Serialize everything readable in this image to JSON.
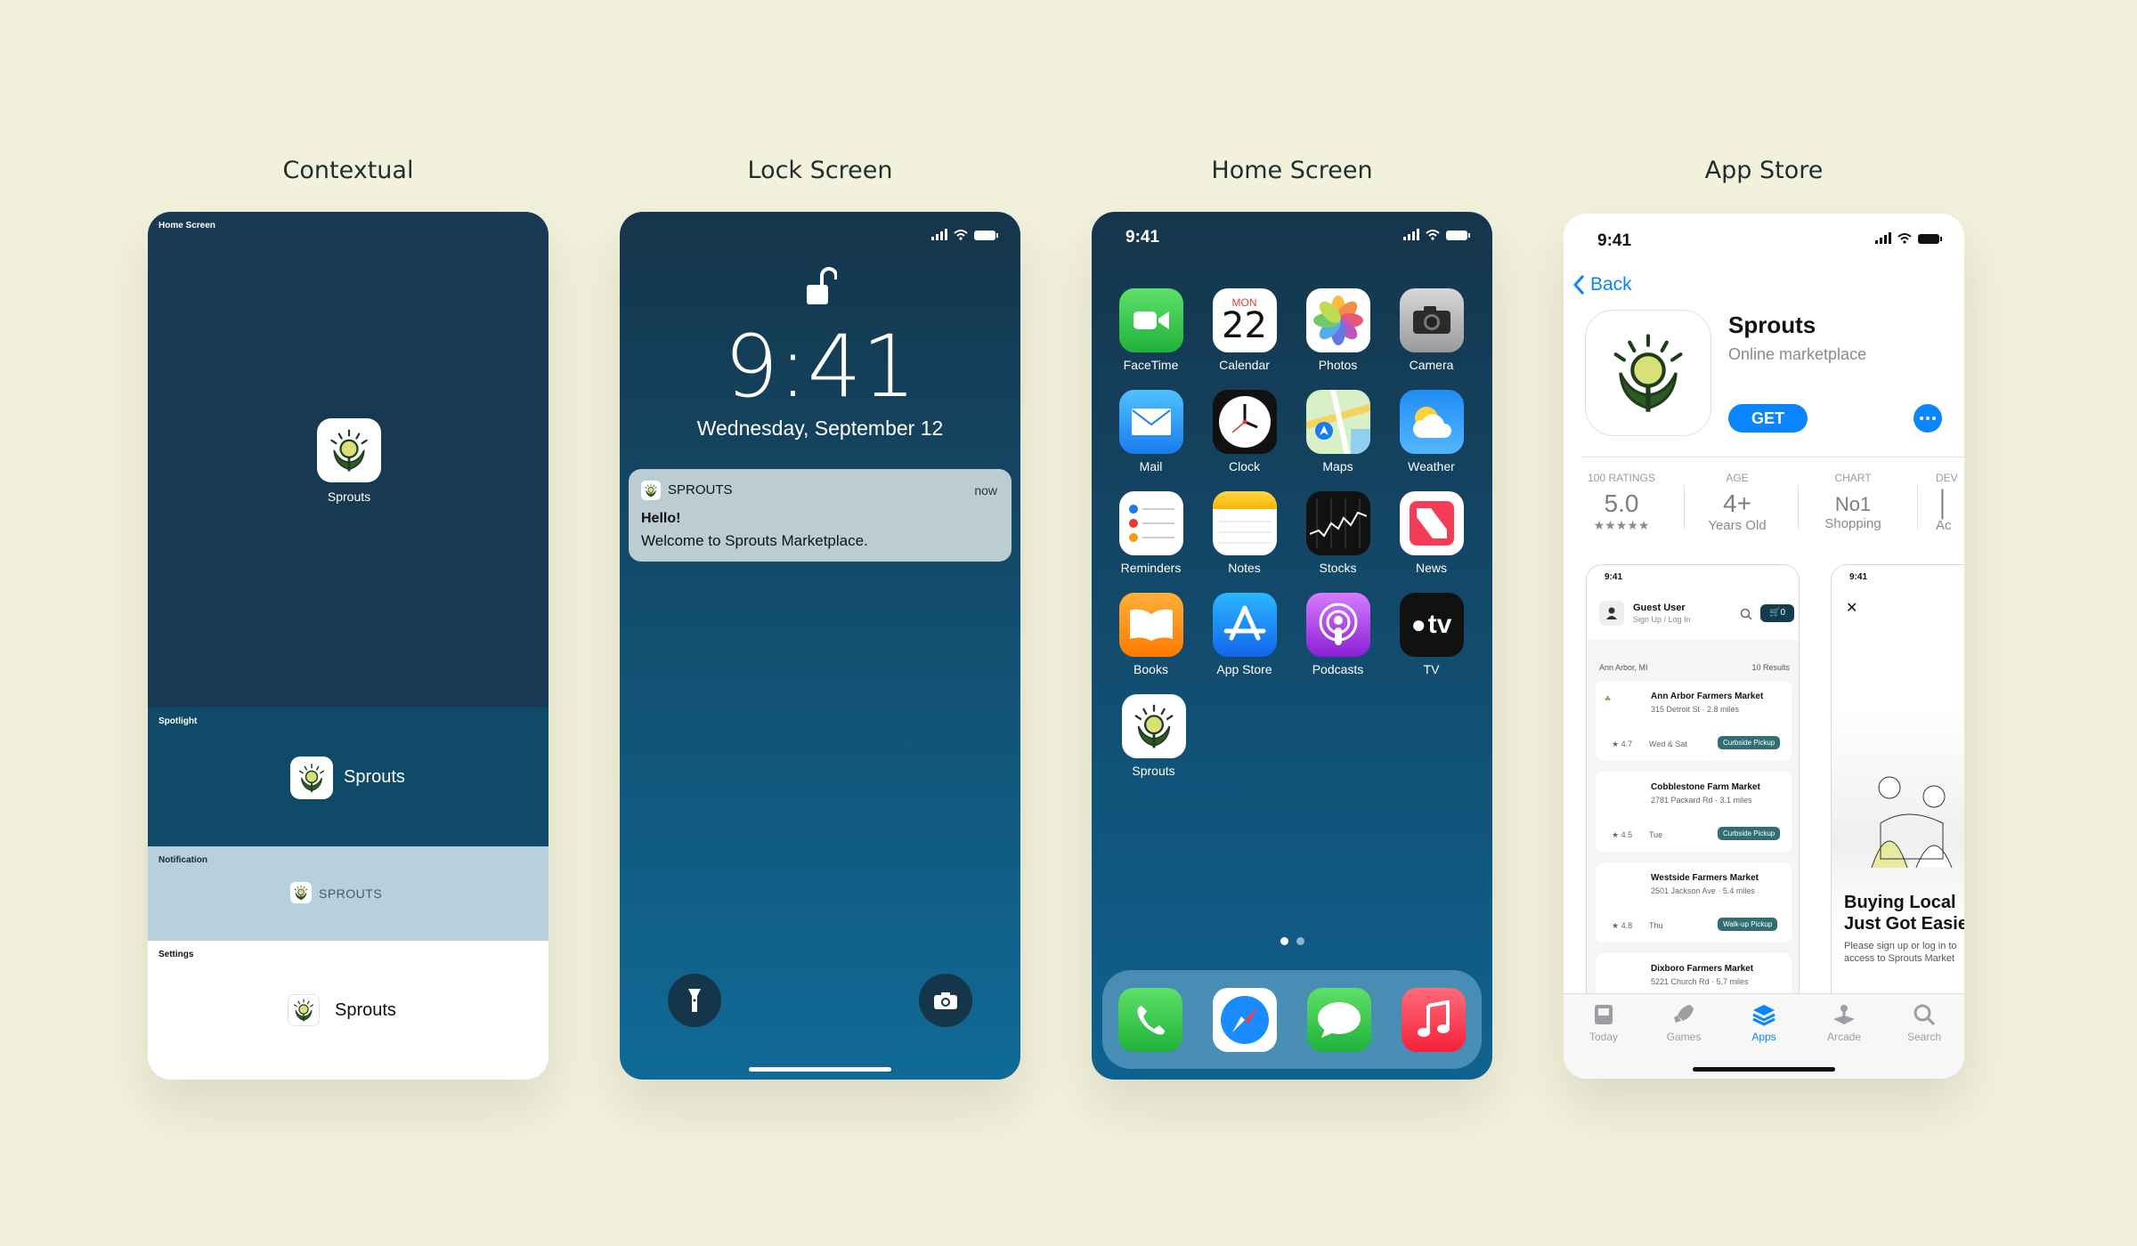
{
  "panel_titles": [
    "Contextual",
    "Lock Screen",
    "Home Screen",
    "App Store"
  ],
  "contextual": {
    "home_label": "Home Screen",
    "app_name": "Sprouts",
    "spotlight_label": "Spotlight",
    "notification_label": "Notification",
    "notification_app": "SPROUTS",
    "settings_label": "Settings"
  },
  "lock": {
    "time": "9:41",
    "date": "Wednesday, September 12",
    "notif_app": "SPROUTS",
    "notif_time": "now",
    "notif_title": "Hello!",
    "notif_body": "Welcome to Sprouts Marketplace."
  },
  "home": {
    "time": "9:41",
    "calendar_day": "MON",
    "calendar_date": "22",
    "apps": [
      "FaceTime",
      "Calendar",
      "Photos",
      "Camera",
      "Mail",
      "Clock",
      "Maps",
      "Weather",
      "Reminders",
      "Notes",
      "Stocks",
      "News",
      "Books",
      "App Store",
      "Podcasts",
      "TV",
      "Sprouts"
    ],
    "tv_text": "tv"
  },
  "store": {
    "time": "9:41",
    "back": "Back",
    "app_name": "Sprouts",
    "subtitle": "Online marketplace",
    "get": "GET",
    "stats": [
      {
        "label": "100 RATINGS",
        "value": "5.0",
        "sub": "★★★★★"
      },
      {
        "label": "AGE",
        "value": "4+",
        "sub": "Years Old"
      },
      {
        "label": "CHART",
        "value": "No1",
        "sub": "Shopping"
      },
      {
        "label": "DEV",
        "value": "",
        "sub": "Ac"
      }
    ],
    "shot1": {
      "time": "9:41",
      "user": "Guest User",
      "signin": "Sign Up / Log In",
      "cart": "0",
      "location": "Ann Arbor, MI",
      "results": "10 Results",
      "markets": [
        {
          "name": "Ann Arbor Farmers Market",
          "addr": "315 Detroit St",
          "dist": "2.8 miles",
          "rating": "4.7",
          "days": "Wed & Sat",
          "tag": "Curbside Pickup"
        },
        {
          "name": "Cobblestone Farm Market",
          "addr": "2781 Packard Rd",
          "dist": "3.1 miles",
          "rating": "4.5",
          "days": "Tue",
          "tag": "Curbside Pickup"
        },
        {
          "name": "Westside Farmers Market",
          "addr": "2501 Jackson Ave",
          "dist": "5.4 miles",
          "rating": "4.8",
          "days": "Thu",
          "tag": "Walk-up Pickup"
        },
        {
          "name": "Dixboro Farmers Market",
          "addr": "5221 Church Rd",
          "dist": "5.7 miles",
          "rating": "",
          "days": "",
          "tag": ""
        }
      ]
    },
    "shot2": {
      "time": "9:41",
      "headline1": "Buying Local",
      "headline2": "Just Got Easie",
      "body1": "Please sign up or log in to",
      "body2": "access to Sprouts Market"
    },
    "tabs": [
      "Today",
      "Games",
      "Apps",
      "Arcade",
      "Search"
    ]
  },
  "colors": {
    "background": "#f2f2dc",
    "accent": "#0a84ff",
    "brand_green": "#2d4a1c",
    "brand_yellow": "#d7e07a"
  }
}
